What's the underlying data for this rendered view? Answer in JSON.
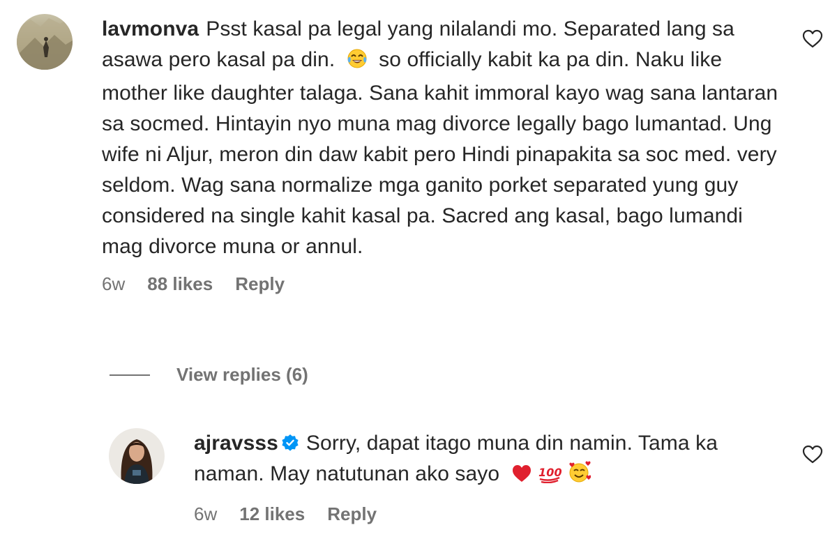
{
  "comments": [
    {
      "username": "lavmonva",
      "text_part1": "Psst kasal pa legal yang nilalandi mo. Separated lang sa asawa pero kasal pa din.",
      "emoji1": "face-with-tears-of-joy",
      "text_part2": "so officially kabit ka pa din. Naku like mother like daughter talaga. Sana kahit immoral kayo wag sana lantaran sa socmed. Hintayin nyo muna mag divorce legally bago lumantad. Ung wife ni Aljur, meron din daw kabit pero Hindi pinapakita sa soc med. very seldom. Wag sana normalize mga ganito porket separated yung guy considered na single kahit kasal pa. Sacred ang kasal, bago lumandi mag divorce muna or annul.",
      "time": "6w",
      "likes": "88 likes",
      "reply_label": "Reply"
    },
    {
      "username": "ajravsss",
      "verified": true,
      "text_part1": "Sorry, dapat itago muna din namin. Tama ka naman. May natutunan ako sayo",
      "emojis": [
        "red-heart",
        "hundred-points",
        "smiling-face-with-hearts"
      ],
      "time": "6w",
      "likes": "12 likes",
      "reply_label": "Reply"
    }
  ],
  "view_replies": "View replies (6)",
  "colors": {
    "text": "#262626",
    "secondary": "#737373",
    "verified": "#0095f6"
  }
}
